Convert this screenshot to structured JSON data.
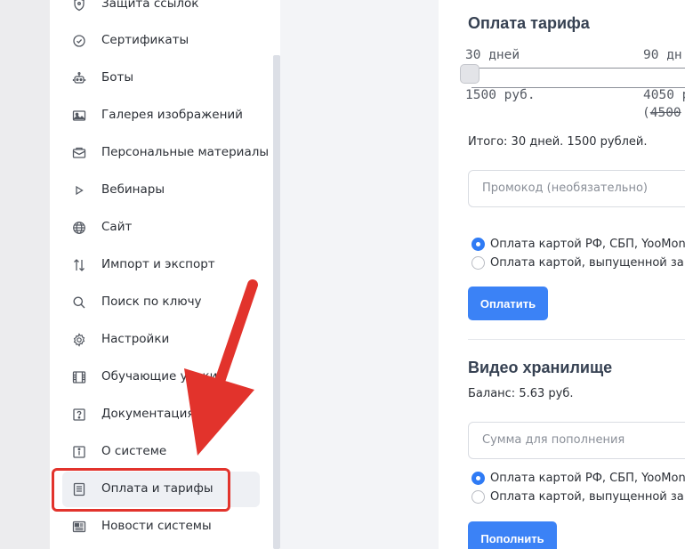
{
  "sidebar": {
    "items": [
      {
        "label": "Защита ссылок",
        "icon": "shield-icon"
      },
      {
        "label": "Сертификаты",
        "icon": "certificate-icon"
      },
      {
        "label": "Боты",
        "icon": "bot-icon"
      },
      {
        "label": "Галерея изображений",
        "icon": "image-icon"
      },
      {
        "label": "Персональные материалы",
        "icon": "envelope-icon"
      },
      {
        "label": "Вебинары",
        "icon": "play-icon"
      },
      {
        "label": "Сайт",
        "icon": "globe-icon"
      },
      {
        "label": "Импорт и экспорт",
        "icon": "arrows-updown-icon"
      },
      {
        "label": "Поиск по ключу",
        "icon": "search-icon"
      },
      {
        "label": "Настройки",
        "icon": "gear-icon"
      },
      {
        "label": "Обучающие уроки",
        "icon": "film-icon"
      },
      {
        "label": "Документация",
        "icon": "question-icon"
      },
      {
        "label": "О системе",
        "icon": "info-icon"
      },
      {
        "label": "Оплата и тарифы",
        "icon": "receipt-icon"
      },
      {
        "label": "Новости системы",
        "icon": "newspaper-icon"
      }
    ],
    "active_index": 13
  },
  "tariff": {
    "title": "Оплата тарифа",
    "slider_label_left": "30 дней",
    "slider_label_right": "90 дн",
    "price_left": "1500 руб.",
    "price_right": "4050 р",
    "price_right_old_prefix": "(",
    "price_right_old": "4500",
    "slider_position": 0,
    "total": "Итого: 30 дней. 1500 рублей.",
    "promo_placeholder": "Промокод (необязательно)",
    "payment_options": [
      {
        "label": "Оплата картой РФ, СБП, YooMon",
        "checked": true
      },
      {
        "label": "Оплата картой, выпущенной за",
        "checked": false
      }
    ],
    "pay_button": "Оплатить"
  },
  "storage": {
    "title": "Видео хранилище",
    "balance": "Баланс: 5.63 руб.",
    "amount_placeholder": "Сумма для пополнения",
    "payment_options": [
      {
        "label": "Оплата картой РФ, СБП, YooMon",
        "checked": true
      },
      {
        "label": "Оплата картой, выпущенной за",
        "checked": false
      }
    ],
    "topup_button": "Пополнить"
  },
  "colors": {
    "accent": "#3b82f6",
    "annotation": "#e2332c"
  }
}
